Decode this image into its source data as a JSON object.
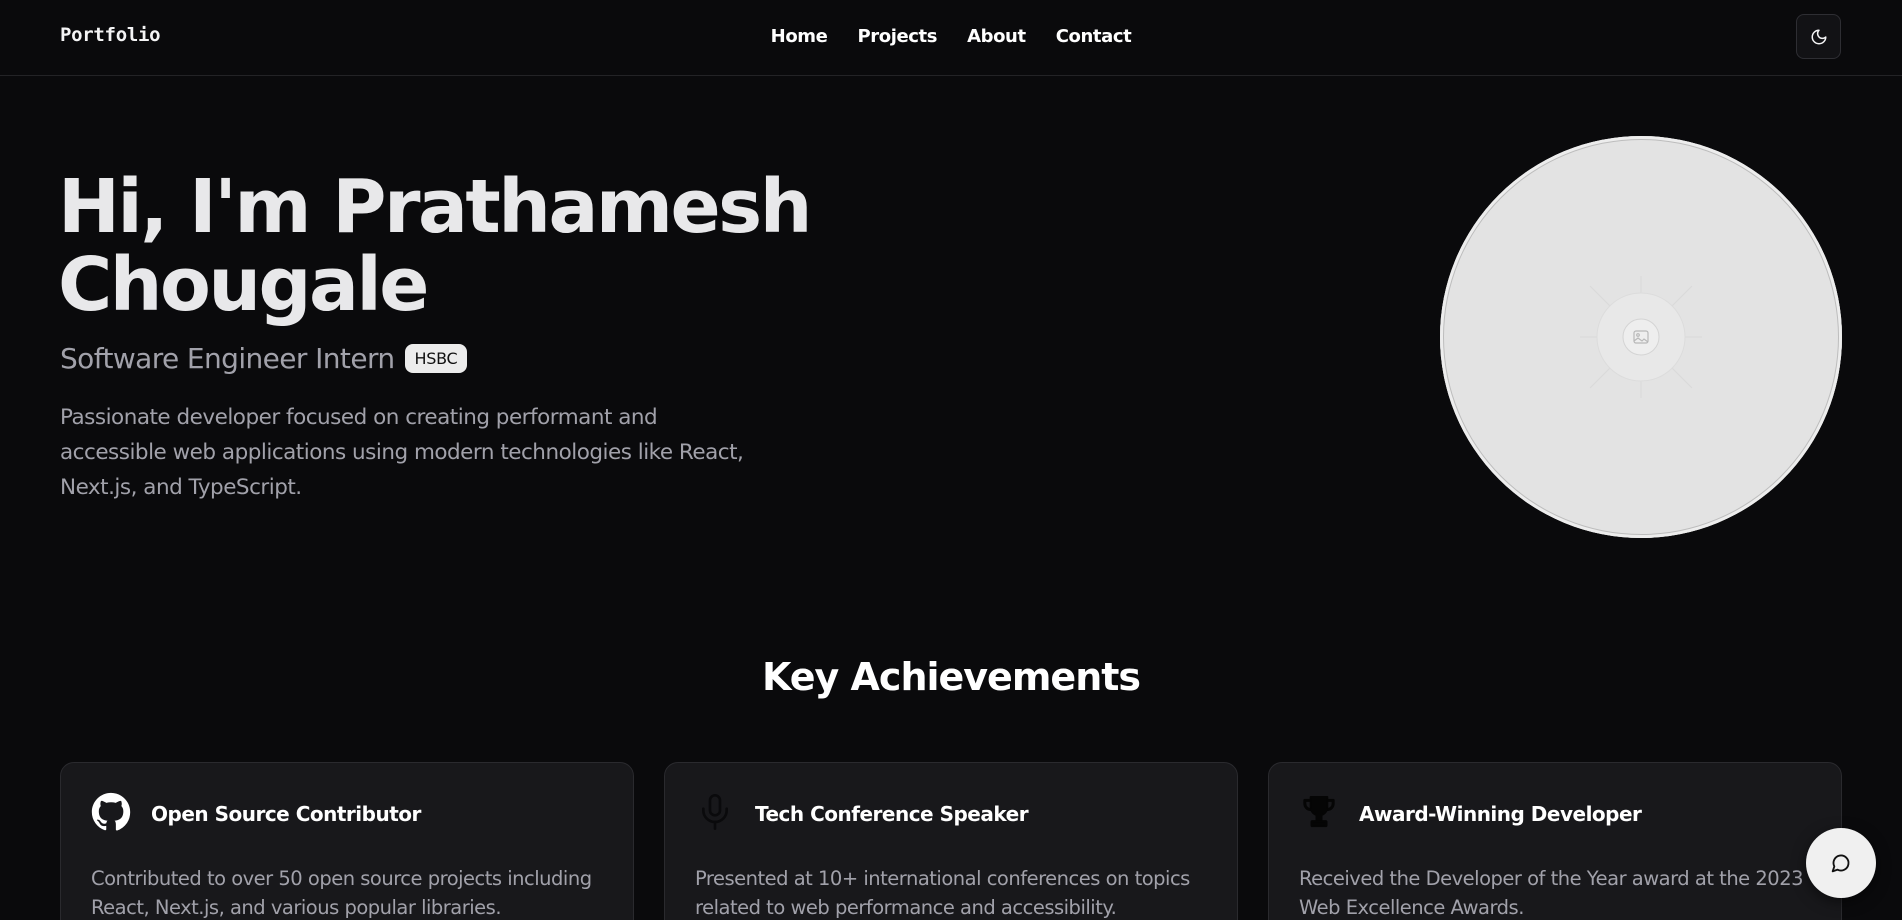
{
  "header": {
    "brand": "Portfolio",
    "nav": [
      "Home",
      "Projects",
      "About",
      "Contact"
    ],
    "theme_toggle_icon": "moon-icon"
  },
  "hero": {
    "title_line1": "Hi, I'm Prathamesh",
    "title_line2": "Chougale",
    "role": "Software Engineer Intern",
    "company_badge": "HSBC",
    "description": "Passionate developer focused on creating performant and accessible web applications using modern technologies like React, Next.js, and TypeScript.",
    "avatar_icon": "image-placeholder-icon"
  },
  "achievements": {
    "heading": "Key Achievements",
    "cards": [
      {
        "icon": "github-icon",
        "title": "Open Source Contributor",
        "description": "Contributed to over 50 open source projects including React, Next.js, and various popular libraries."
      },
      {
        "icon": "microphone-icon",
        "title": "Tech Conference Speaker",
        "description": "Presented at 10+ international conferences on topics related to web performance and accessibility."
      },
      {
        "icon": "trophy-icon",
        "title": "Award-Winning Developer",
        "description": "Received the Developer of the Year award at the 2023 Web Excellence Awards."
      }
    ]
  },
  "chat": {
    "icon": "chat-bubble-icon"
  },
  "colors": {
    "background": "#0a0a0c",
    "card": "#18181b",
    "muted_text": "#a1a1aa",
    "badge_bg": "#ececec"
  }
}
